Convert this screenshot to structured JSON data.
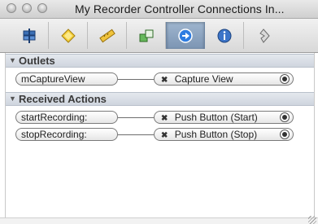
{
  "window": {
    "title": "My Recorder Controller Connections In..."
  },
  "toolbar": {
    "tabs": [
      {
        "icon": "attributes-icon"
      },
      {
        "icon": "effects-icon"
      },
      {
        "icon": "size-ruler-icon"
      },
      {
        "icon": "bindings-icon"
      },
      {
        "icon": "connections-icon",
        "active": true
      },
      {
        "icon": "identity-info-icon"
      },
      {
        "icon": "applescript-icon"
      }
    ]
  },
  "outlets": {
    "header": "Outlets",
    "rows": [
      {
        "name": "mCaptureView",
        "target": "Capture View"
      }
    ]
  },
  "actions": {
    "header": "Received Actions",
    "rows": [
      {
        "name": "startRecording:",
        "target": "Push Button (Start)"
      },
      {
        "name": "stopRecording:",
        "target": "Push Button (Stop)"
      }
    ]
  },
  "colors": {
    "accent": "#7c95b3",
    "section_bg": "#d9dee6"
  }
}
